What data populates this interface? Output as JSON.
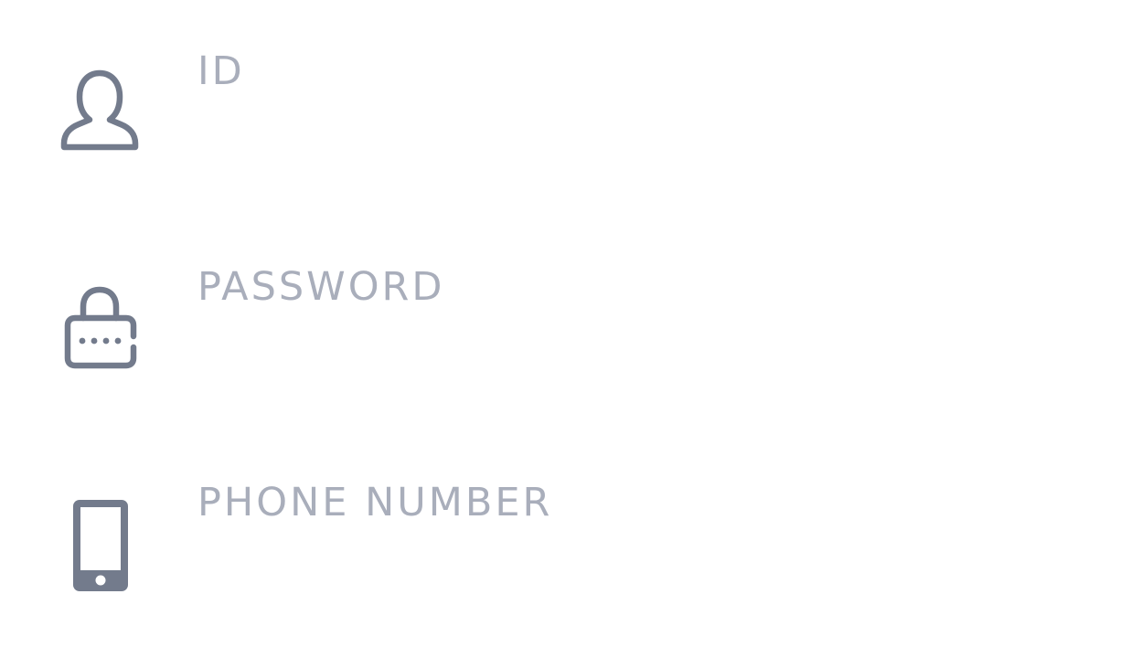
{
  "colors": {
    "icon": "#737b8c",
    "placeholder": "#a9aebb",
    "background": "#ffffff"
  },
  "fields": [
    {
      "icon": "user-icon",
      "placeholder": "ID",
      "value": ""
    },
    {
      "icon": "lock-icon",
      "placeholder": "PASSWORD",
      "value": ""
    },
    {
      "icon": "phone-icon",
      "placeholder": "PHONE NUMBER",
      "value": ""
    }
  ]
}
